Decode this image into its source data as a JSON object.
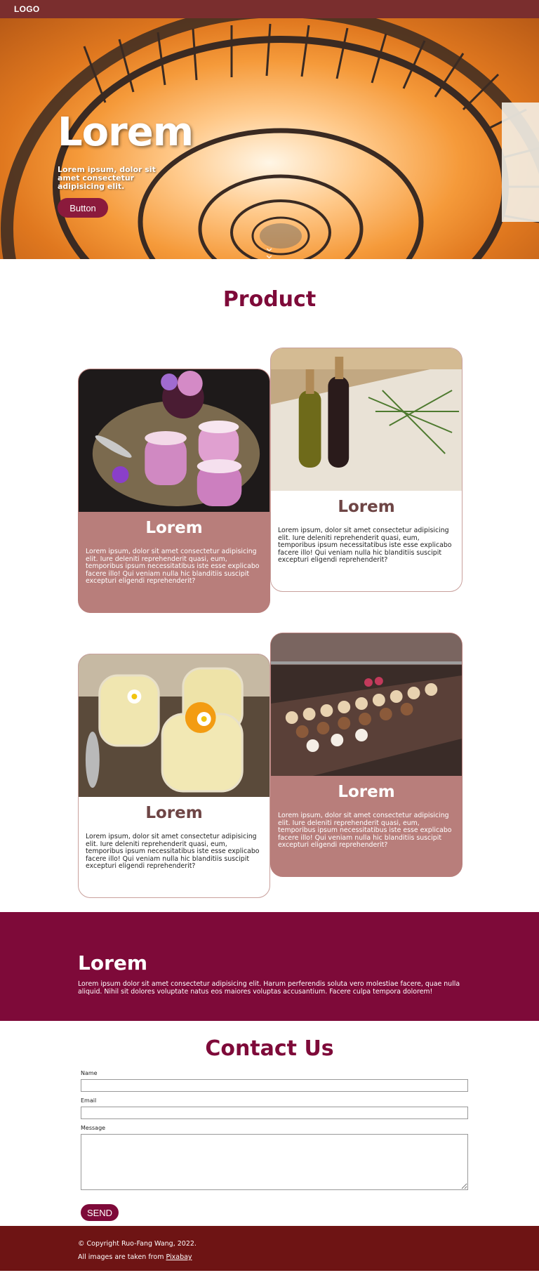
{
  "nav": {
    "logo": "LOGO"
  },
  "hero": {
    "title": "Lorem",
    "subtitle": "Lorem ipsum, dolor sit amet consectetur adipisicing elit.",
    "button_label": "Button",
    "scroll_icon": "double-chevron-down-icon"
  },
  "product": {
    "title": "Product",
    "cards": [
      {
        "title": "Lorem",
        "text": "Lorem ipsum, dolor sit amet consectetur adipisicing elit. Iure deleniti reprehenderit quasi, eum, temporibus ipsum necessitatibus iste esse explicabo facere illo! Qui veniam nulla hic blanditiis suscipit excepturi eligendi reprehenderit?",
        "style": "filled"
      },
      {
        "title": "Lorem",
        "text": "Lorem ipsum, dolor sit amet consectetur adipisicing elit. Iure deleniti reprehenderit quasi, eum, temporibus ipsum necessitatibus iste esse explicabo facere illo! Qui veniam nulla hic blanditiis suscipit excepturi eligendi reprehenderit?",
        "style": "plain"
      },
      {
        "title": "Lorem",
        "text": "Lorem ipsum, dolor sit amet consectetur adipisicing elit. Iure deleniti reprehenderit quasi, eum, temporibus ipsum necessitatibus iste esse explicabo facere illo! Qui veniam nulla hic blanditiis suscipit excepturi eligendi reprehenderit?",
        "style": "plain"
      },
      {
        "title": "Lorem",
        "text": "Lorem ipsum, dolor sit amet consectetur adipisicing elit. Iure deleniti reprehenderit quasi, eum, temporibus ipsum necessitatibus iste esse explicabo facere illo! Qui veniam nulla hic blanditiis suscipit excepturi eligendi reprehenderit?",
        "style": "filled"
      }
    ]
  },
  "banner": {
    "title": "Lorem",
    "text": "Lorem ipsum dolor sit amet consectetur adipisicing elit. Harum perferendis soluta vero molestiae facere, quae nulla aliquid. Nihil sit dolores voluptate natus eos maiores voluptas accusantium. Facere culpa tempora dolorem!"
  },
  "contact": {
    "title": "Contact Us",
    "name_label": "Name",
    "email_label": "Email",
    "message_label": "Message",
    "name_value": "",
    "email_value": "",
    "message_value": "",
    "send_label": "SEND"
  },
  "footer": {
    "copyright": "© Copyright Ruo-Fang Wang, 2022.",
    "images_prefix": "All images are taken from ",
    "images_link": "Pixabay"
  },
  "colors": {
    "nav": "#7a2e2e",
    "brand": "#7e0a39",
    "card_fill": "#b87e7b",
    "footer": "#6e1414"
  }
}
